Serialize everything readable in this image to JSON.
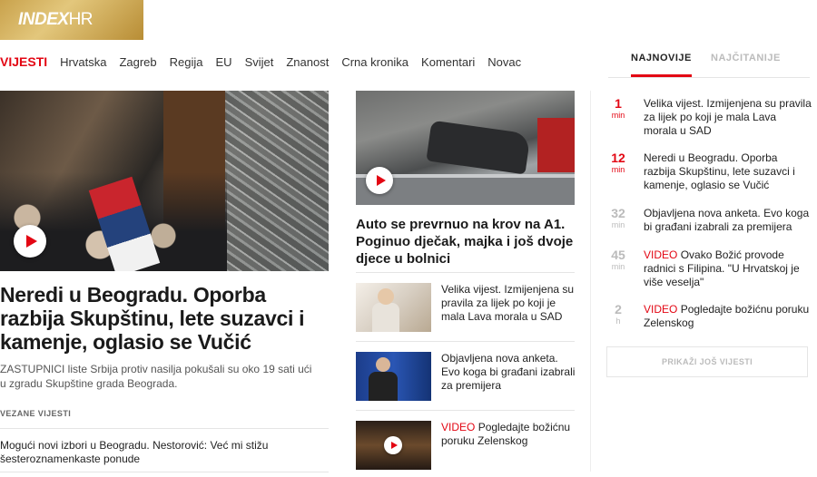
{
  "logo": {
    "brand": "INDEX",
    "suffix": "HR"
  },
  "nav": {
    "section": "VIJESTI",
    "items": [
      "Hrvatska",
      "Zagreb",
      "Regija",
      "EU",
      "Svijet",
      "Znanost",
      "Crna kronika",
      "Komentari",
      "Novac"
    ]
  },
  "tabs": {
    "active": "NAJNOVIJE",
    "inactive": "NAJČITANIJE"
  },
  "lead": {
    "title": "Neredi u Beogradu. Oporba razbija Skupštinu, lete suzavci i kamenje, oglasio se Vučić",
    "subtitle": "ZASTUPNICI liste Srbija protiv nasilja pokušali su oko 19 sati ući u zgradu Skupštine grada Beograda.",
    "related_label": "VEZANE VIJESTI",
    "related_link": "Mogući novi izbori u Beogradu. Nestorović: Već mi stižu šesteroznamenkaste ponude"
  },
  "middle": {
    "title": "Auto se prevrnuo na krov na A1. Poginuo dječak, majka i još dvoje djece u bolnici",
    "items": [
      {
        "tag": "",
        "text": "Velika vijest. Izmijenjena su pravila za lijek po koji je mala Lava morala u SAD"
      },
      {
        "tag": "",
        "text": "Objavljena nova anketa. Evo koga bi građani izabrali za premijera"
      },
      {
        "tag": "VIDEO",
        "text": "Pogledajte božićnu poruku Zelenskog"
      }
    ]
  },
  "feed": {
    "items": [
      {
        "num": "1",
        "unit": "min",
        "tag": "",
        "text": "Velika vijest. Izmijenjena su pravila za lijek po koji je mala Lava morala u SAD"
      },
      {
        "num": "12",
        "unit": "min",
        "tag": "",
        "text": "Neredi u Beogradu. Oporba razbija Skupštinu, lete suzavci i kamenje, oglasio se Vučić"
      },
      {
        "num": "32",
        "unit": "min",
        "tag": "",
        "text": "Objavljena nova anketa. Evo koga bi građani izabrali za premijera"
      },
      {
        "num": "45",
        "unit": "min",
        "tag": "VIDEO",
        "text": "Ovako Božić provode radnici s Filipina. \"U Hrvatskoj je više veselja\""
      },
      {
        "num": "2",
        "unit": "h",
        "tag": "VIDEO",
        "text": "Pogledajte božićnu poruku Zelenskog"
      }
    ],
    "more_button": "PRIKAŽI JOŠ VIJESTI"
  },
  "colors": {
    "accent": "#e30613",
    "gold": "#c9a24c"
  }
}
